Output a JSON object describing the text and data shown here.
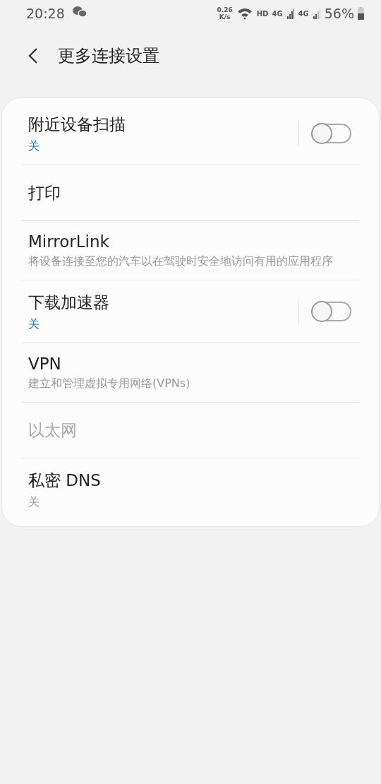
{
  "status_bar": {
    "time": "20:28",
    "speed_value": "0.26",
    "speed_unit": "K/s",
    "network_label": "HD",
    "sim_1": "4G",
    "sim_2": "4G",
    "battery": "56%"
  },
  "header": {
    "title": "更多连接设置"
  },
  "items": [
    {
      "kind": "toggle",
      "title": "附近设备扫描",
      "summary": "关",
      "on": false,
      "disabled": false
    },
    {
      "kind": "plain",
      "title": "打印",
      "disabled": false
    },
    {
      "kind": "plain",
      "title": "MirrorLink",
      "summary": "将设备连接至您的汽车以在驾驶时安全地访问有用的应用程序",
      "disabled": false
    },
    {
      "kind": "toggle",
      "title": "下载加速器",
      "summary": "关",
      "on": false,
      "disabled": false
    },
    {
      "kind": "plain",
      "title": "VPN",
      "summary": "建立和管理虚拟专用网络(VPNs)",
      "disabled": false
    },
    {
      "kind": "plain",
      "title": "以太网",
      "disabled": true
    },
    {
      "kind": "plain",
      "title": "私密 DNS",
      "summary": "关",
      "disabled": false
    }
  ]
}
